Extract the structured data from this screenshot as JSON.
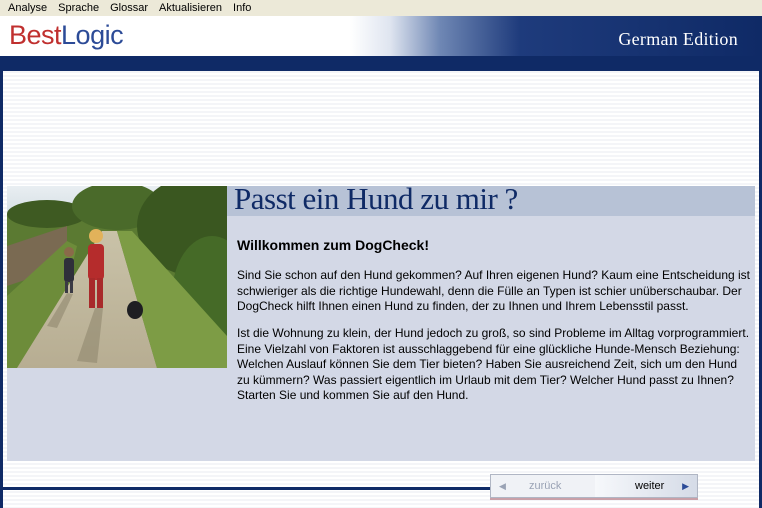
{
  "menu": [
    "Analyse",
    "Sprache",
    "Glossar",
    "Aktualisieren",
    "Info"
  ],
  "brand": {
    "part1": "Best",
    "part2": "Logic",
    "edition": "German Edition"
  },
  "content": {
    "title": "Passt ein Hund zu mir ?",
    "welcome": "Willkommen zum DogCheck!",
    "paragraph1": "Sind Sie schon auf den Hund gekommen? Auf Ihren eigenen Hund? Kaum eine Entscheidung ist schwieriger als die richtige Hundewahl, denn die Fülle an Typen ist schier unüberschaubar. Der DogCheck hilft Ihnen einen Hund zu finden, der zu Ihnen und Ihrem Lebensstil passt.",
    "paragraph2": "Ist die Wohnung zu klein, der Hund jedoch zu groß, so sind Probleme im Alltag vorprogrammiert. Eine Vielzahl von Faktoren ist ausschlaggebend für eine glückliche Hunde-Mensch Beziehung: Welchen Auslauf können Sie dem Tier bieten? Haben Sie ausreichend Zeit, sich um den Hund zu kümmern? Was passiert eigentlich im Urlaub mit dem Tier? Welcher Hund passt zu Ihnen? Starten Sie und kommen Sie auf den Hund."
  },
  "nav": {
    "back_label": "zurück",
    "next_label": "weiter"
  },
  "colors": {
    "navy": "#0f2a66",
    "brand_red": "#c0302f",
    "brand_blue": "#2c4b97",
    "panel": "#d3d8e6"
  }
}
